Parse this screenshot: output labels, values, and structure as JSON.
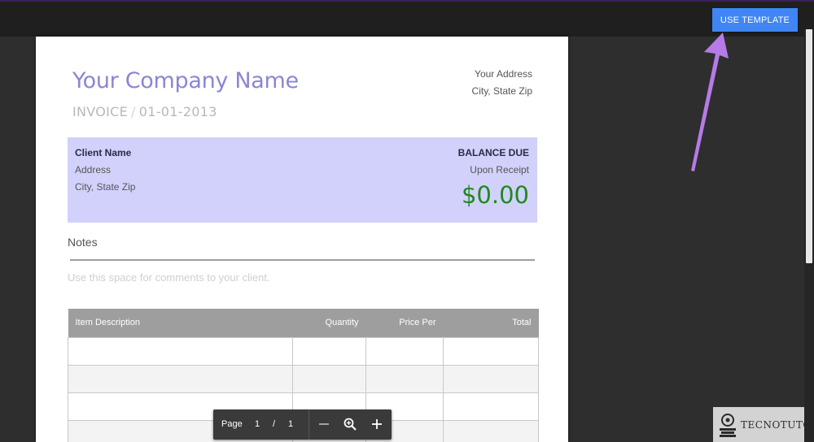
{
  "toolbar": {
    "use_template_label": "USE TEMPLATE"
  },
  "invoice": {
    "company_name": "Your Company Name",
    "invoice_label": "INVOICE",
    "separator": "/",
    "invoice_date": "01-01-2013",
    "address_line1": "Your Address",
    "address_line2": "City, State Zip",
    "client": {
      "name": "Client Name",
      "address": "Address",
      "city": "City, State Zip"
    },
    "balance": {
      "label": "BALANCE DUE",
      "terms": "Upon Receipt",
      "amount": "$0.00"
    },
    "notes": {
      "title": "Notes",
      "placeholder": "Use this space for comments to your client."
    },
    "table": {
      "headers": [
        "Item Description",
        "Quantity",
        "Price Per",
        "Total"
      ]
    }
  },
  "pager": {
    "label": "Page",
    "current": "1",
    "separator": "/",
    "total": "1"
  },
  "watermark": {
    "text": "TECNOTUTO"
  },
  "colors": {
    "accent_button": "#3f85f4",
    "company_name": "#8a86d4",
    "client_box": "#d2d1fb",
    "amount": "#1e8a1e",
    "arrow": "#b57be6"
  }
}
